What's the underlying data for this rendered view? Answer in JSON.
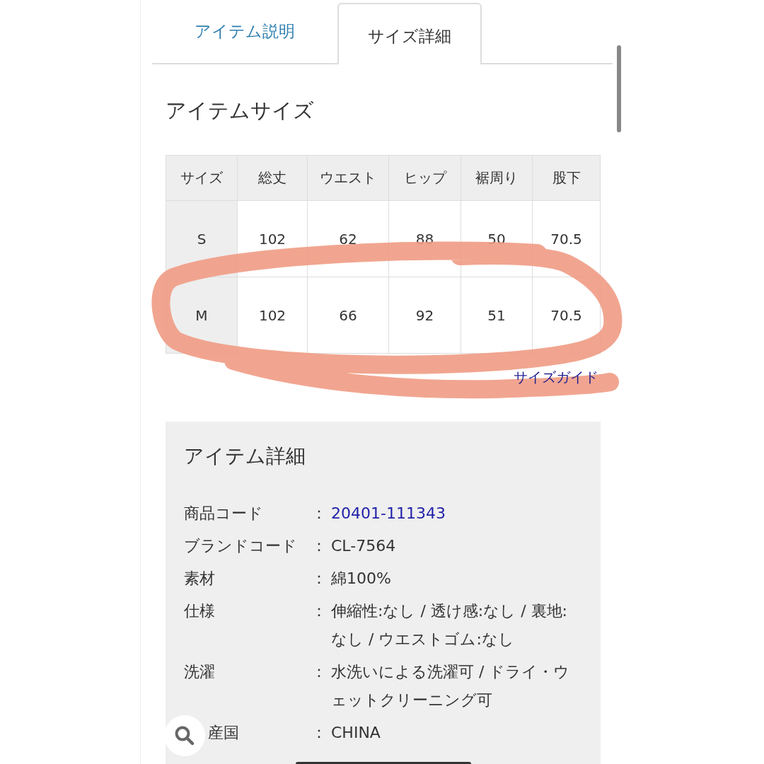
{
  "tabs": [
    {
      "label": "アイテム説明",
      "selected": false
    },
    {
      "label": "サイズ詳細",
      "selected": true
    }
  ],
  "size_section": {
    "title": "アイテムサイズ",
    "columns": [
      "サイズ",
      "総丈",
      "ウエスト",
      "ヒップ",
      "裾周り",
      "股下"
    ],
    "rows": [
      [
        "S",
        "102",
        "62",
        "88",
        "50",
        "70.5"
      ],
      [
        "M",
        "102",
        "66",
        "92",
        "51",
        "70.5"
      ]
    ],
    "guide_link": "サイズガイド"
  },
  "details": {
    "title": "アイテム詳細",
    "separator": "：",
    "rows": [
      {
        "label": "商品コード",
        "value": "20401-111343",
        "kind": "link"
      },
      {
        "label": "ブランドコード",
        "value": "CL-7564",
        "kind": "text"
      },
      {
        "label": "素材",
        "value": "綿100%",
        "kind": "text"
      },
      {
        "label": "仕様",
        "value": "伸縮性:なし / 透け感:なし / 裏地:なし / ウエストゴム:なし",
        "kind": "text"
      },
      {
        "label": "洗濯",
        "value": "水洗いによる洗濯可 / ドライ・ウェットクリーニング可",
        "kind": "text"
      },
      {
        "label": "産国",
        "value": "CHINA",
        "kind": "text"
      }
    ]
  }
}
